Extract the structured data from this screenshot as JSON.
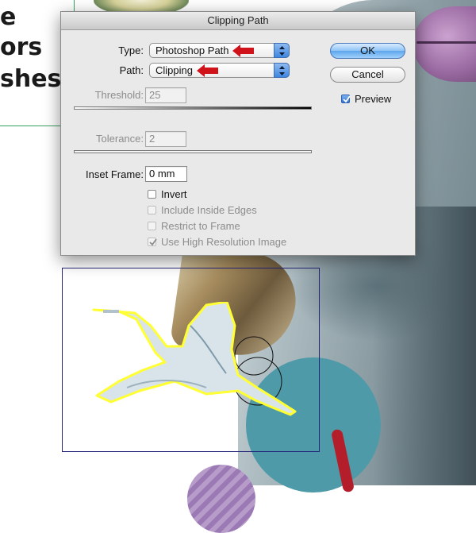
{
  "document": {
    "text_lines": [
      "e",
      "ors",
      "shes"
    ]
  },
  "dialog": {
    "title": "Clipping Path",
    "type_label": "Type:",
    "type_value": "Photoshop Path",
    "path_label": "Path:",
    "path_value": "Clipping",
    "threshold_label": "Threshold:",
    "threshold_value": "25",
    "tolerance_label": "Tolerance:",
    "tolerance_value": "2",
    "inset_label": "Inset Frame:",
    "inset_value": "0 mm",
    "checkboxes": [
      {
        "label": "Invert",
        "checked": false,
        "enabled": true
      },
      {
        "label": "Include Inside Edges",
        "checked": false,
        "enabled": false
      },
      {
        "label": "Restrict to Frame",
        "checked": false,
        "enabled": false
      },
      {
        "label": "Use High Resolution Image",
        "checked": true,
        "enabled": false
      }
    ],
    "ok_label": "OK",
    "cancel_label": "Cancel",
    "preview_label": "Preview",
    "preview_checked": true
  },
  "colors": {
    "accent_blue": "#3f86e0",
    "annotation_red": "#d0121b",
    "path_yellow": "#ffff33",
    "frame_navy": "#26267a"
  },
  "icons": [
    "stepper-arrows-icon",
    "red-arrow-icon",
    "checkmark-icon"
  ]
}
